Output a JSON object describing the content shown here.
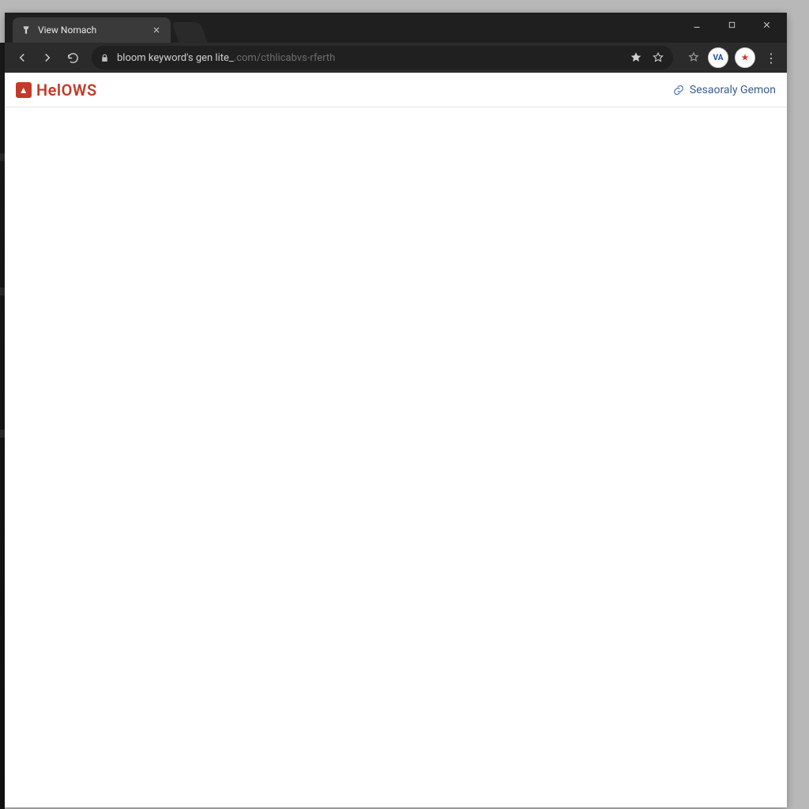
{
  "browser": {
    "tab_title": "View Nomach",
    "url_primary": "bloom keyword's gen lite_",
    "url_secondary": ".com/cthlicabvs-rferth"
  },
  "page": {
    "brand_name": "HelOWS",
    "brand_logo_glyph": "▲",
    "header_link_label": "Sesaoraly Gemon"
  },
  "extensions": {
    "slot1_label": "VA",
    "slot2_label": "★"
  }
}
